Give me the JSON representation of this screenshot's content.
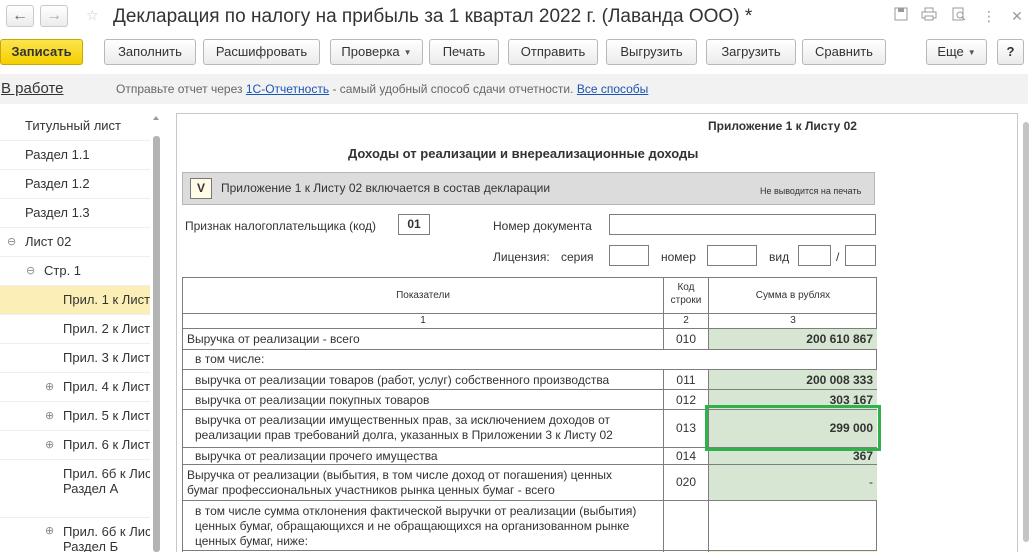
{
  "titlebar": {
    "title": "Декларация по налогу на прибыль за 1 квартал 2022 г. (Лаванда ООО) *",
    "back_icon": "←",
    "forward_icon": "→"
  },
  "toolbar": {
    "save": "Записать",
    "fill": "Заполнить",
    "decode": "Расшифровать",
    "check": "Проверка",
    "print": "Печать",
    "send": "Отправить",
    "export": "Выгрузить",
    "import": "Загрузить",
    "compare": "Сравнить",
    "more": "Еще",
    "help": "?"
  },
  "infobar": {
    "tab": "В работе",
    "text_before": "Отправьте отчет через",
    "link1": "1С-Отчетность",
    "text_after": "- самый удобный способ сдачи отчетности.",
    "link2": "Все способы"
  },
  "sidebar": {
    "items": [
      {
        "label": "Титульный лист"
      },
      {
        "label": "Раздел 1.1"
      },
      {
        "label": "Раздел 1.2"
      },
      {
        "label": "Раздел 1.3"
      },
      {
        "label": "Лист 02"
      },
      {
        "label": "Стр. 1"
      },
      {
        "label": "Прил. 1 к Лист"
      },
      {
        "label": "Прил. 2 к Лист"
      },
      {
        "label": "Прил. 3 к Лист"
      },
      {
        "label": "Прил. 4 к Лист"
      },
      {
        "label": "Прил. 5 к Лист"
      },
      {
        "label": "Прил. 6 к Лист"
      },
      {
        "label": "Прил. 6б к Лис",
        "label2": "Раздел А"
      },
      {
        "label": "Прил. 6б к Лис",
        "label2": "Раздел Б"
      }
    ]
  },
  "form": {
    "appendix_title": "Приложение 1 к Листу 02",
    "heading": "Доходы от реализации и внереализационные доходы",
    "include_mark": "V",
    "include_text": "Приложение 1 к Листу 02 включается в состав декларации",
    "no_print": "Не выводится на печать",
    "taxpayer_label": "Признак налогоплательщика (код)",
    "taxpayer_code": "01",
    "doc_number_label": "Номер документа",
    "license_label": "Лицензия:",
    "series_label": "серия",
    "number_label": "номер",
    "type_label": "вид",
    "slash": "/",
    "table": {
      "headers": [
        "Показатели",
        "Код строки",
        "Сумма в рублях"
      ],
      "col_numbers": [
        "1",
        "2",
        "3"
      ],
      "rows": [
        {
          "label": "Выручка от реализации - всего",
          "code": "010",
          "value": "200 610 867"
        },
        {
          "label": "в том числе:",
          "code": "",
          "value": ""
        },
        {
          "label": "выручка от реализации товаров (работ, услуг) собственного производства",
          "code": "011",
          "value": "200 008 333"
        },
        {
          "label": "выручка от реализации покупных товаров",
          "code": "012",
          "value": "303 167"
        },
        {
          "label": "выручка от реализации имущественных прав, за исключением доходов от",
          "label2": "реализации прав требований долга, указанных в Приложении 3 к Листу 02",
          "code": "013",
          "value": "299 000"
        },
        {
          "label": "выручка от реализации прочего имущества",
          "code": "014",
          "value": "367"
        },
        {
          "label": "Выручка от реализации (выбытия, в том числе доход от погашения) ценных",
          "label2": "бумаг профессиональных участников рынка ценных бумаг - всего",
          "code": "020",
          "value": "-"
        },
        {
          "label": "в том числе сумма отклонения фактической выручки от реализации (выбытия)",
          "label2": "ценных бумаг, обращающихся и не обращающихся на организованном рынке",
          "label3": "ценных бумаг, ниже:",
          "code": "",
          "value": ""
        }
      ]
    }
  }
}
